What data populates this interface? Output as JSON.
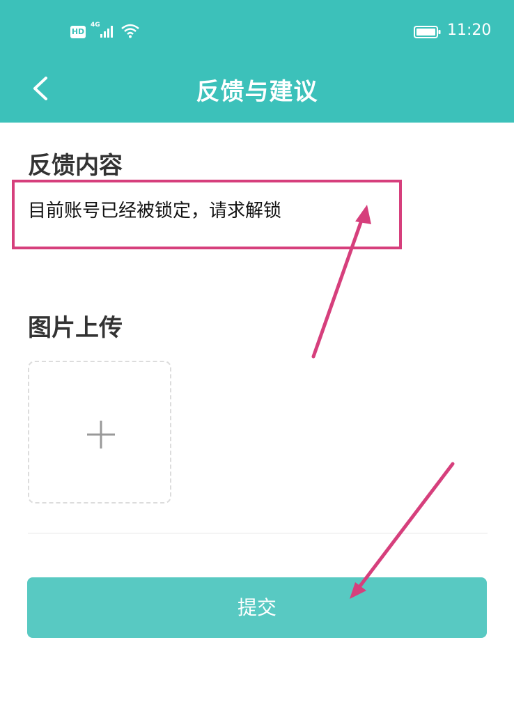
{
  "status_bar": {
    "hd_badge": "HD",
    "network": "4G",
    "time": "11:20"
  },
  "header": {
    "title": "反馈与建议",
    "back_icon": "chevron-left-icon"
  },
  "feedback": {
    "section_title": "反馈内容",
    "content": "目前账号已经被锁定，请求解锁"
  },
  "upload": {
    "section_title": "图片上传",
    "add_icon": "plus-icon"
  },
  "submit": {
    "label": "提交"
  },
  "colors": {
    "header_bg": "#3cc1ba",
    "button_bg": "#58c9c2",
    "annotation": "#d63f7c"
  }
}
